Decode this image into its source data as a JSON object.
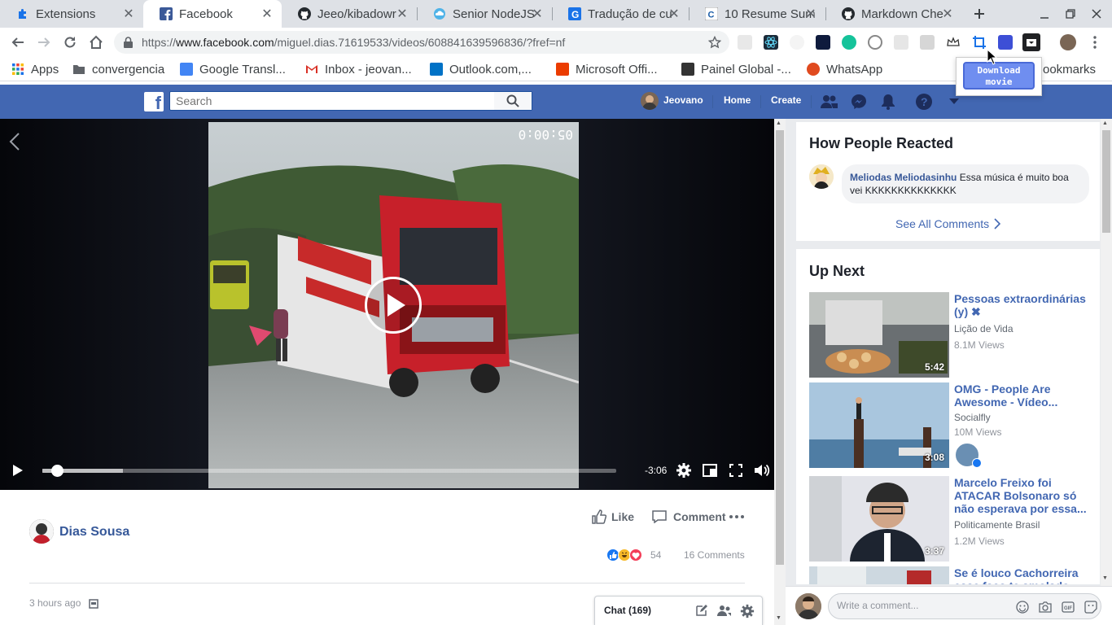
{
  "tabs": [
    {
      "label": "Extensions",
      "icon": "puzzle-icon"
    },
    {
      "label": "Facebook",
      "icon": "facebook-icon",
      "active": true
    },
    {
      "label": "Jeeo/kibadowr",
      "icon": "github-icon"
    },
    {
      "label": "Senior NodeJS",
      "icon": "cloud-icon"
    },
    {
      "label": "Tradução de cu",
      "icon": "google-translate-icon"
    },
    {
      "label": "10 Resume Sum",
      "icon": "c-icon"
    },
    {
      "label": "Markdown Che",
      "icon": "github-icon"
    }
  ],
  "toolbar": {
    "url_prefix": "https://",
    "url_host": "www.facebook.com",
    "url_path": "/miguel.dias.71619533/videos/608841639596836/?fref=nf"
  },
  "bookmarks": [
    {
      "label": "Apps",
      "icon": "apps-grid-icon"
    },
    {
      "label": "convergencia",
      "icon": "folder-icon"
    },
    {
      "label": "Google Transl...",
      "icon": "google-translate-icon"
    },
    {
      "label": "Inbox - jeovan...",
      "icon": "gmail-icon"
    },
    {
      "label": "Outlook.com,...",
      "icon": "outlook-icon"
    },
    {
      "label": "Microsoft Offi...",
      "icon": "office-icon"
    },
    {
      "label": "Painel Global -...",
      "icon": "painel-icon"
    },
    {
      "label": "WhatsApp",
      "icon": "whatsapp-icon"
    },
    {
      "label": "ookmarks",
      "icon": ""
    }
  ],
  "popup": {
    "download_label": "Download movie"
  },
  "fb": {
    "search_placeholder": "Search",
    "user_name": "Jeovano",
    "home": "Home",
    "create": "Create"
  },
  "video": {
    "time_left": "-3:06",
    "progress": 0.015,
    "buffered": 0.14
  },
  "post": {
    "author": "Dias Sousa",
    "like": "Like",
    "comment": "Comment",
    "reaction_count": "54",
    "comments_count": "16 Comments",
    "time_ago": "3 hours ago"
  },
  "chat": {
    "label": "Chat (169)"
  },
  "reacted": {
    "title": "How People Reacted",
    "comment_author": "Meliodas Meliodasinhu",
    "comment_text": " Essa música é muito boa vei KKKKKKKKKKKKKK",
    "see_all": "See All Comments"
  },
  "upnext": {
    "title": "Up Next",
    "items": [
      {
        "title": "Pessoas extraordinárias (y) ✖",
        "channel": "Lição de Vida",
        "views": "8.1M Views",
        "duration": "5:42"
      },
      {
        "title": "OMG - People Are Awesome - Vídeo...",
        "channel": "Socialfly",
        "views": "10M Views",
        "duration": "3:08"
      },
      {
        "title": "Marcelo Freixo foi ATACAR Bolsonaro só não esperava por essa...",
        "channel": "Politicamente Brasil",
        "views": "1.2M Views",
        "duration": "3:37"
      },
      {
        "title": "Se é louco Cachorreira esse faço te amolado",
        "channel": "",
        "views": "",
        "duration": ""
      }
    ]
  },
  "comment_box": {
    "placeholder": "Write a comment..."
  },
  "colors": {
    "fb_blue": "#4267b2",
    "link": "#365899",
    "tab_bg": "#dee1e6"
  }
}
